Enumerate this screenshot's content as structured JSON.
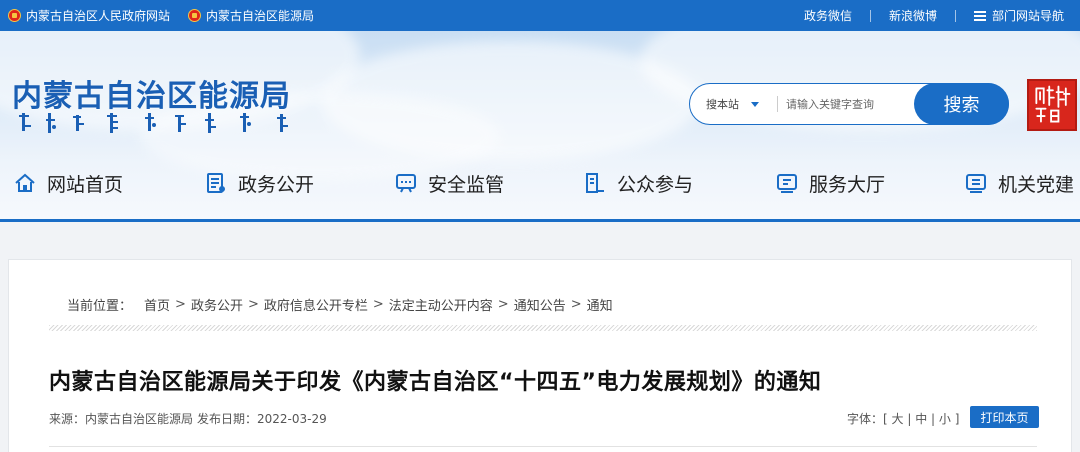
{
  "topbar": {
    "links_left": [
      "内蒙古自治区人民政府网站",
      "内蒙古自治区能源局"
    ],
    "wechat": "政务微信",
    "weibo": "新浪微博",
    "dept_nav": "部门网站导航",
    "color": "#1a6dc6"
  },
  "header": {
    "site_name": "内蒙古自治区能源局",
    "search": {
      "scope": "搜本站",
      "placeholder": "请输入关键字查询",
      "button": "搜索"
    }
  },
  "nav": {
    "items": [
      {
        "label": "网站首页",
        "icon": "home-icon"
      },
      {
        "label": "政务公开",
        "icon": "document-icon"
      },
      {
        "label": "安全监管",
        "icon": "monitor-icon"
      },
      {
        "label": "公众参与",
        "icon": "participation-icon"
      },
      {
        "label": "服务大厅",
        "icon": "service-icon"
      },
      {
        "label": "机关党建",
        "icon": "party-icon"
      }
    ]
  },
  "breadcrumb": {
    "label": "当前位置：",
    "items": [
      "首页",
      "政务公开",
      "政府信息公开专栏",
      "法定主动公开内容",
      "通知公告",
      "通知"
    ]
  },
  "article": {
    "title": "内蒙古自治区能源局关于印发《内蒙古自治区“十四五”电力发展规划》的通知",
    "source": "来源：内蒙古自治区能源局",
    "date": "发布日期：2022-03-29",
    "font_label": "字体：",
    "font_large": "大",
    "font_medium": "中",
    "font_small": "小",
    "print_button": "打印本页"
  }
}
